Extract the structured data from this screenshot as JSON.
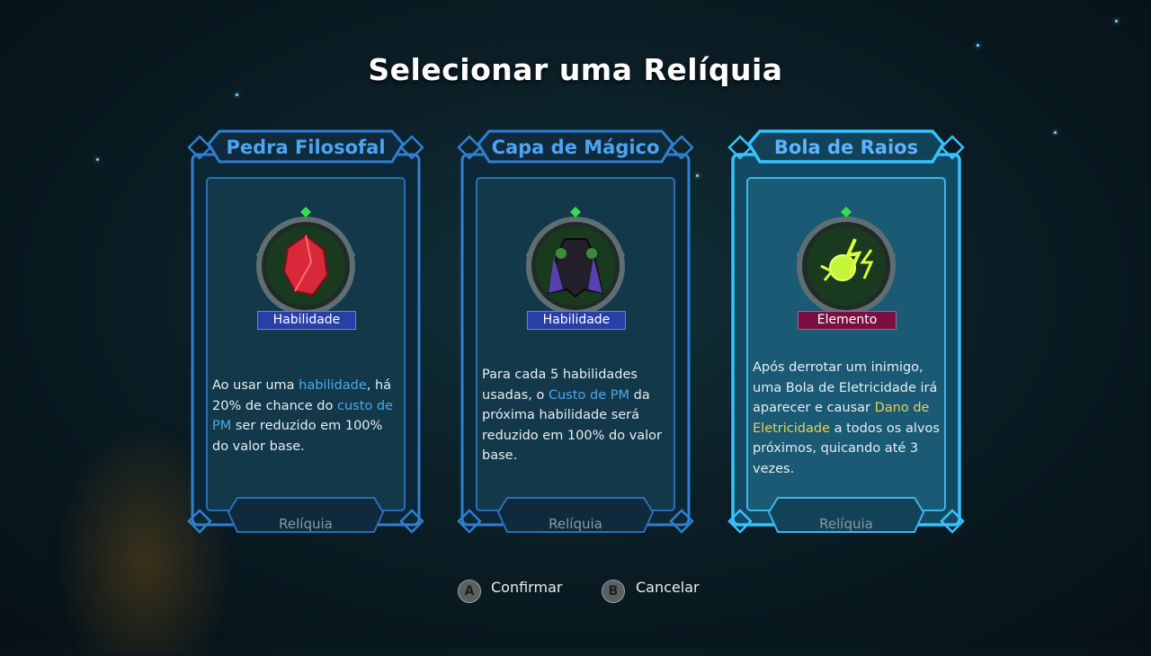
{
  "screen": {
    "title": "Selecionar uma Relíquia"
  },
  "cards": [
    {
      "name": "Pedra Filosofal",
      "type_tag": "Habilidade",
      "description": {
        "p1": "Ao usar uma ",
        "h1": "habilidade",
        "p2": ", há 20% de chance do ",
        "h2": "custo de PM",
        "p3": " ser reduzido em 100% do valor base."
      },
      "footer": "Relíquia",
      "icon": "red-crystal-icon",
      "selected": false
    },
    {
      "name": "Capa de Mágico",
      "type_tag": "Habilidade",
      "description": {
        "p1": "Para cada 5 habilidades usadas, o ",
        "h1": "Custo de PM",
        "p2": " da próxima habilidade será reduzido em 100% do valor base."
      },
      "footer": "Relíquia",
      "icon": "magic-cape-icon",
      "selected": false
    },
    {
      "name": "Bola de Raios",
      "type_tag": "Elemento",
      "description": {
        "p1": "Após derrotar um inimigo, uma Bola de Eletricidade irá aparecer e causar ",
        "h1": "Dano de Eletricidade",
        "p2": " a todos os alvos próximos, quicando até 3 vezes."
      },
      "footer": "Relíquia",
      "icon": "lightning-ball-icon",
      "selected": true
    }
  ],
  "controls": {
    "confirm": {
      "button": "A",
      "label": "Confirmar"
    },
    "cancel": {
      "button": "B",
      "label": "Cancelar"
    }
  },
  "colors": {
    "frame_blue": "#2f7fd0",
    "frame_selected": "#36c2ff",
    "tag_skill": "#2a3ea8",
    "tag_element": "#7a0f44",
    "highlight_blue": "#4fa7e8",
    "highlight_yellow": "#e3d25a"
  }
}
